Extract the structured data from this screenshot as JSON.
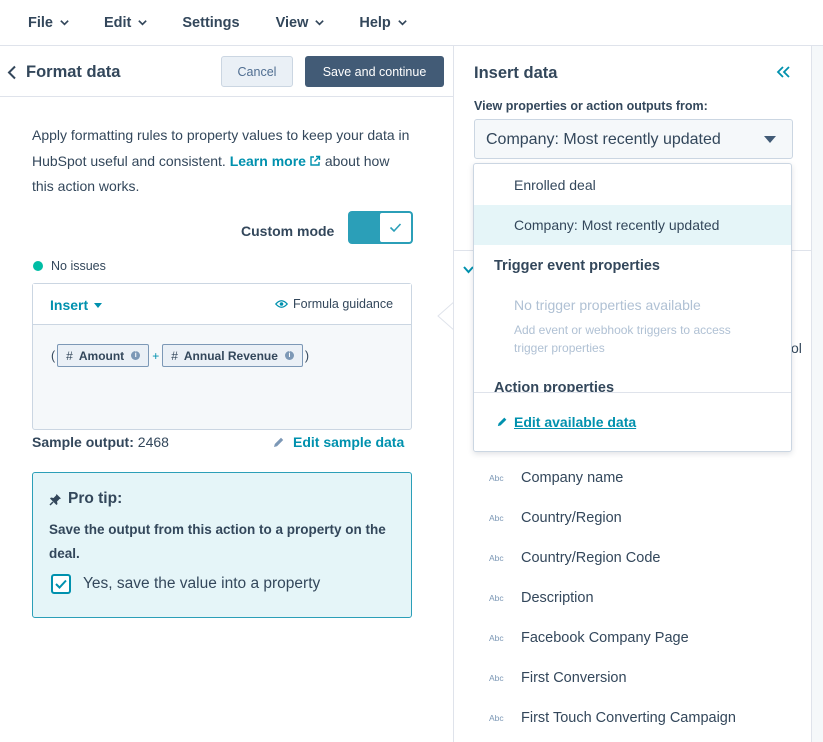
{
  "menubar": {
    "items": [
      {
        "label": "File",
        "has_menu": true
      },
      {
        "label": "Edit",
        "has_menu": true
      },
      {
        "label": "Settings",
        "has_menu": false
      },
      {
        "label": "View",
        "has_menu": true
      },
      {
        "label": "Help",
        "has_menu": true
      }
    ]
  },
  "left": {
    "title": "Format data",
    "cancel_label": "Cancel",
    "save_label": "Save and continue",
    "description_pre": "Apply formatting rules to property values to keep your data in HubSpot useful and consistent.",
    "learn_more": "Learn more",
    "description_post": "about how this action works.",
    "custom_mode_label": "Custom mode",
    "custom_mode_on": true,
    "status": "No issues",
    "insert_label": "Insert",
    "guidance_label": "Formula guidance",
    "formula": {
      "open_paren": "(",
      "token1": "Amount",
      "operator": "+",
      "token2": "Annual Revenue",
      "close_paren": ")",
      "hash": "#",
      "info": "i"
    },
    "sample_output_label": "Sample output:",
    "sample_output_value": "2468",
    "edit_sample_label": "Edit sample data",
    "protip": {
      "title": "Pro tip:",
      "body": "Save the output from this action to a property on the deal.",
      "checkbox_label": "Yes, save the value into a property",
      "checked": true
    }
  },
  "right": {
    "title": "Insert data",
    "view_label": "View properties or action outputs from:",
    "selected_source": "Company: Most recently updated",
    "partial_char": "ol",
    "properties": [
      {
        "type": "Abc",
        "name": "Company name"
      },
      {
        "type": "Abc",
        "name": "Country/Region"
      },
      {
        "type": "Abc",
        "name": "Country/Region Code"
      },
      {
        "type": "Abc",
        "name": "Description"
      },
      {
        "type": "Abc",
        "name": "Facebook Company Page"
      },
      {
        "type": "Abc",
        "name": "First Conversion"
      },
      {
        "type": "Abc",
        "name": "First Touch Converting Campaign"
      }
    ]
  },
  "dropdown": {
    "options": [
      {
        "label": "Enrolled deal",
        "selected": false
      },
      {
        "label": "Company: Most recently updated",
        "selected": true
      }
    ],
    "trigger_group": "Trigger event properties",
    "trigger_empty": "No trigger properties available",
    "trigger_hint": "Add event or webhook triggers to access trigger properties",
    "action_group": "Action properties",
    "edit_label": "Edit available data"
  },
  "colors": {
    "accent": "#0091ae",
    "toggle": "#2b9fb8",
    "primary_button": "#425b76",
    "text": "#33475b",
    "status_ok": "#00bda5",
    "tip_bg": "#e5f5f8"
  }
}
